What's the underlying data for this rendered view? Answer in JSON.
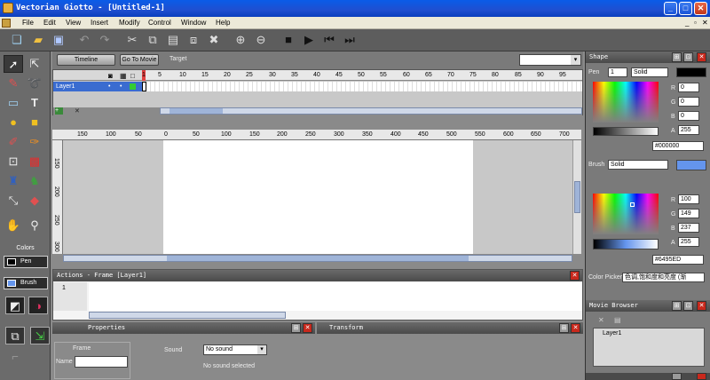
{
  "window": {
    "title": "Vectorian Giotto - [Untitled-1]",
    "min": "_",
    "max": "□",
    "close": "✕"
  },
  "menu": [
    "File",
    "Edit",
    "View",
    "Insert",
    "Modify",
    "Control",
    "Window",
    "Help"
  ],
  "timeline": {
    "timeline_btn": "Timeline",
    "goto_btn": "Go To Movie",
    "target_label": "Target",
    "layer": "Layer1",
    "ticks": [
      "1",
      "5",
      "10",
      "15",
      "20",
      "25",
      "30",
      "35",
      "40",
      "45",
      "50",
      "55",
      "60",
      "65",
      "70",
      "75",
      "80",
      "85",
      "90",
      "95"
    ]
  },
  "stage": {
    "ruler": [
      "150",
      "100",
      "50",
      "0",
      "50",
      "100",
      "150",
      "200",
      "250",
      "300",
      "350",
      "400",
      "450",
      "500",
      "550",
      "600",
      "650",
      "700"
    ],
    "vruler": [
      "150",
      "200",
      "250",
      "300"
    ]
  },
  "actions": {
    "title": "Actions - Frame [Layer1]",
    "line": "1"
  },
  "properties": {
    "title": "Properties",
    "frame_label": "Frame",
    "name_label": "Name",
    "sound_label": "Sound",
    "sound_value": "No sound",
    "sound_status": "No sound selected"
  },
  "transform": {
    "title": "Transform"
  },
  "tools": {
    "colors_label": "Colors",
    "pen_label": "Pen",
    "brush_label": "Brush"
  },
  "shape": {
    "title": "Shape",
    "pen_label": "Pen",
    "pen_width": "1",
    "pen_style": "Solid",
    "pen_r": "0",
    "pen_g": "0",
    "pen_b": "0",
    "pen_a": "255",
    "pen_hex": "#000000",
    "brush_label": "Brush",
    "brush_style": "Solid",
    "brush_r": "100",
    "brush_g": "149",
    "brush_b": "237",
    "brush_a": "255",
    "brush_hex": "#6495ED",
    "r_lbl": "R",
    "g_lbl": "G",
    "b_lbl": "B",
    "a_lbl": "A",
    "picker_label": "Color Picker",
    "picker_value": "色调,饱和度和亮度 (渐"
  },
  "movie_browser": {
    "title": "Movie Browser",
    "item": "Layer1"
  },
  "colors": {
    "brush": "#6495ED",
    "pen": "#000000",
    "accent_red": "#c8281c"
  }
}
